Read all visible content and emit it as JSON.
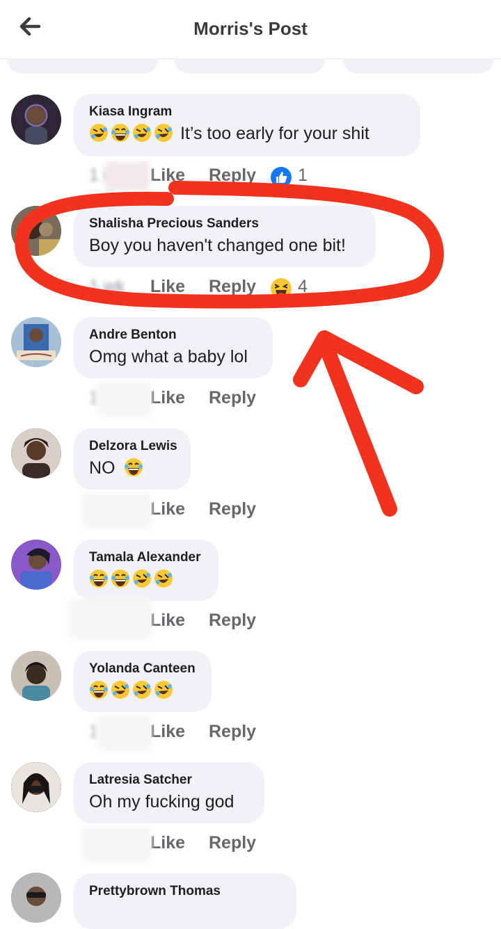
{
  "header": {
    "title": "Morris's Post",
    "back_icon": "back-arrow-icon"
  },
  "comments": [
    {
      "name": "Kiasa Ingram",
      "emojis": [
        "rofl",
        "joy",
        "rofl",
        "rofl"
      ],
      "text": "It’s too early for your shit",
      "time": "1 w",
      "like": "Like",
      "reply": "Reply",
      "reaction": "thumbs-up-icon",
      "reaction_count": "1",
      "avatar_color": "#3a3448"
    },
    {
      "name": "Shalisha Precious Sanders",
      "emojis": [],
      "text": "Boy you haven't changed one bit!",
      "time": "1 wk",
      "like": "Like",
      "reply": "Reply",
      "reaction": "laughing-squint-icon",
      "reaction_count": "4",
      "avatar_color": "#5a4a3a"
    },
    {
      "name": "Andre Benton",
      "emojis": [],
      "text": "Omg what a baby lol",
      "time": "1",
      "like": "Like",
      "reply": "Reply",
      "avatar_color": "#6f8fb0"
    },
    {
      "name": "Delzora Lewis",
      "emojis_after": [
        "joy"
      ],
      "text": "NO",
      "time": "",
      "like": "Like",
      "reply": "Reply",
      "avatar_color": "#4a3a34"
    },
    {
      "name": "Tamala Alexander",
      "emojis": [
        "joy",
        "joy",
        "rofl",
        "rofl"
      ],
      "text": "",
      "time": "",
      "like": "Like",
      "reply": "Reply",
      "avatar_color": "#6a4a9a"
    },
    {
      "name": "Yolanda Canteen",
      "emojis": [
        "joy",
        "rofl",
        "rofl",
        "rofl"
      ],
      "text": "",
      "time": "1",
      "like": "Like",
      "reply": "Reply",
      "avatar_color": "#4a4036"
    },
    {
      "name": "Latresia Satcher",
      "emojis": [],
      "text": "Oh my fucking god",
      "time": "",
      "like": "Like",
      "reply": "Reply",
      "avatar_color": "#2a2220"
    },
    {
      "name": "Prettybrown Thomas",
      "emojis": [],
      "text": "",
      "avatar_color": "#8a8a8a"
    }
  ],
  "colors": {
    "annotation_red": "#f0321e",
    "like_blue": "#1877f2",
    "emoji_yellow": "#f7c836",
    "bubble_bg": "#f0f2f5",
    "action_gray": "#65676b"
  }
}
